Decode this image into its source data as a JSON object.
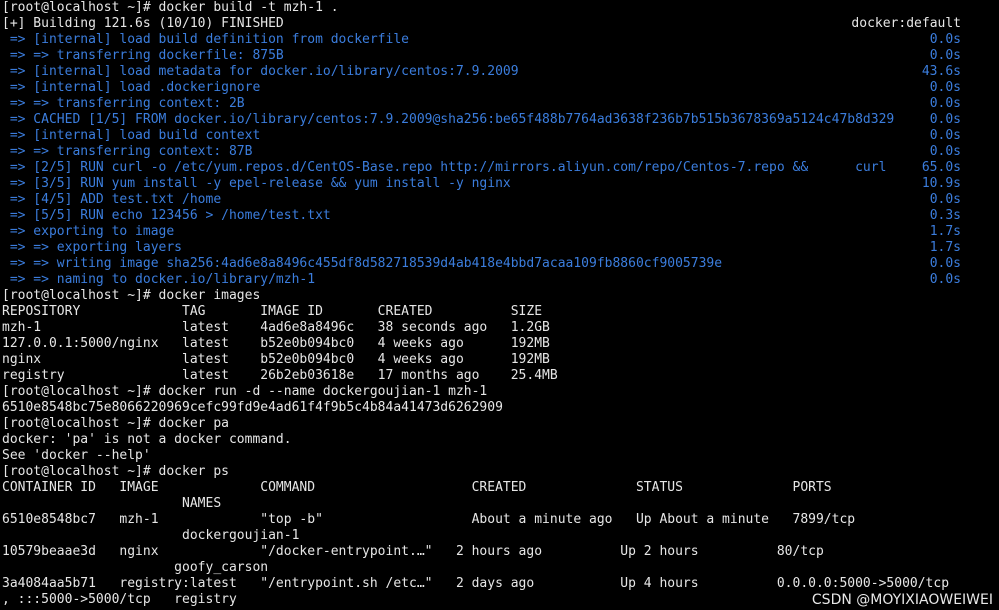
{
  "colors": {
    "background": "#000000",
    "text": "#e6e6e6",
    "buildkit_progress": "#3b7ddd"
  },
  "terminal": {
    "lines": [
      {
        "text": "[root@localhost ~]# docker build -t mzh-1 .",
        "right": "",
        "color": "normal"
      },
      {
        "text": "[+] Building 121.6s (10/10) FINISHED",
        "right": "docker:default",
        "color": "normal"
      },
      {
        "text": " => [internal] load build definition from dockerfile",
        "right": "0.0s",
        "color": "blue"
      },
      {
        "text": " => => transferring dockerfile: 875B",
        "right": "0.0s",
        "color": "blue"
      },
      {
        "text": " => [internal] load metadata for docker.io/library/centos:7.9.2009",
        "right": "43.6s",
        "color": "blue"
      },
      {
        "text": " => [internal] load .dockerignore",
        "right": "0.0s",
        "color": "blue"
      },
      {
        "text": " => => transferring context: 2B",
        "right": "0.0s",
        "color": "blue"
      },
      {
        "text": " => CACHED [1/5] FROM docker.io/library/centos:7.9.2009@sha256:be65f488b7764ad3638f236b7b515b3678369a5124c47b8d329",
        "right": "0.0s",
        "color": "blue"
      },
      {
        "text": " => [internal] load build context",
        "right": "0.0s",
        "color": "blue"
      },
      {
        "text": " => => transferring context: 87B",
        "right": "0.0s",
        "color": "blue"
      },
      {
        "text": " => [2/5] RUN curl -o /etc/yum.repos.d/CentOS-Base.repo http://mirrors.aliyun.com/repo/Centos-7.repo &&      curl",
        "right": "65.0s",
        "color": "blue"
      },
      {
        "text": " => [3/5] RUN yum install -y epel-release && yum install -y nginx",
        "right": "10.9s",
        "color": "blue"
      },
      {
        "text": " => [4/5] ADD test.txt /home",
        "right": "0.0s",
        "color": "blue"
      },
      {
        "text": " => [5/5] RUN echo 123456 > /home/test.txt",
        "right": "0.3s",
        "color": "blue"
      },
      {
        "text": " => exporting to image",
        "right": "1.7s",
        "color": "blue"
      },
      {
        "text": " => => exporting layers",
        "right": "1.7s",
        "color": "blue"
      },
      {
        "text": " => => writing image sha256:4ad6e8a8496c455df8d582718539d4ab418e4bbd7acaa109fb8860cf9005739e",
        "right": "0.0s",
        "color": "blue"
      },
      {
        "text": " => => naming to docker.io/library/mzh-1",
        "right": "0.0s",
        "color": "blue"
      },
      {
        "text": "[root@localhost ~]# docker images",
        "right": "",
        "color": "normal"
      },
      {
        "text": "REPOSITORY             TAG       IMAGE ID       CREATED          SIZE",
        "right": "",
        "color": "normal"
      },
      {
        "text": "mzh-1                  latest    4ad6e8a8496c   38 seconds ago   1.2GB",
        "right": "",
        "color": "normal"
      },
      {
        "text": "127.0.0.1:5000/nginx   latest    b52e0b094bc0   4 weeks ago      192MB",
        "right": "",
        "color": "normal"
      },
      {
        "text": "nginx                  latest    b52e0b094bc0   4 weeks ago      192MB",
        "right": "",
        "color": "normal"
      },
      {
        "text": "registry               latest    26b2eb03618e   17 months ago    25.4MB",
        "right": "",
        "color": "normal"
      },
      {
        "text": "[root@localhost ~]# docker run -d --name dockergoujian-1 mzh-1",
        "right": "",
        "color": "normal"
      },
      {
        "text": "6510e8548bc75e8066220969cefc99fd9e4ad61f4f9b5c4b84a41473d6262909",
        "right": "",
        "color": "normal"
      },
      {
        "text": "[root@localhost ~]# docker pa",
        "right": "",
        "color": "normal"
      },
      {
        "text": "docker: 'pa' is not a docker command.",
        "right": "",
        "color": "normal"
      },
      {
        "text": "See 'docker --help'",
        "right": "",
        "color": "normal"
      },
      {
        "text": "[root@localhost ~]# docker ps",
        "right": "",
        "color": "normal"
      },
      {
        "text": "CONTAINER ID   IMAGE             COMMAND                    CREATED              STATUS              PORTS",
        "right": "",
        "color": "normal"
      },
      {
        "text": "                       NAMES",
        "right": "",
        "color": "normal"
      },
      {
        "text": "6510e8548bc7   mzh-1             \"top -b\"                   About a minute ago   Up About a minute   7899/tcp",
        "right": "",
        "color": "normal"
      },
      {
        "text": "                       dockergoujian-1",
        "right": "",
        "color": "normal"
      },
      {
        "text": "10579beaae3d   nginx             \"/docker-entrypoint.…\"   2 hours ago          Up 2 hours          80/tcp",
        "right": "",
        "color": "normal"
      },
      {
        "text": "                      goofy_carson",
        "right": "",
        "color": "normal"
      },
      {
        "text": "3a4084aa5b71   registry:latest   \"/entrypoint.sh /etc…\"   2 days ago           Up 4 hours          0.0.0.0:5000->5000/tcp",
        "right": "",
        "color": "normal"
      },
      {
        "text": ", :::5000->5000/tcp   registry",
        "right": "",
        "color": "normal"
      }
    ]
  },
  "watermark": "CSDN @MOYIXIAOWEIWEI"
}
